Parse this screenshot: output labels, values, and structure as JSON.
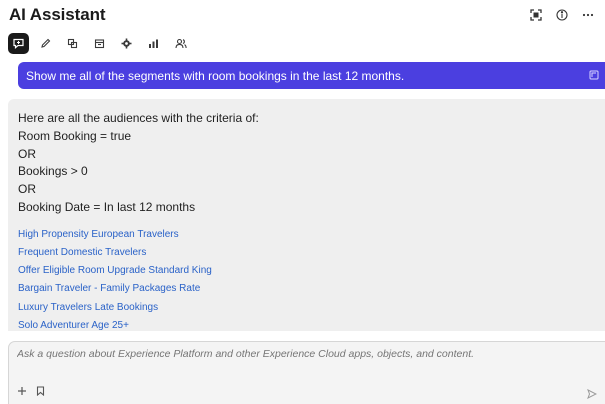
{
  "header": {
    "title": "AI Assistant",
    "icons": [
      "expand-icon",
      "info-icon",
      "more-icon"
    ]
  },
  "toolbar": {
    "tools": [
      {
        "name": "chat-tool",
        "icon": "chat-sparkle-icon",
        "active": true
      },
      {
        "name": "edit-tool",
        "icon": "pencil-icon",
        "active": false
      },
      {
        "name": "copy-tool",
        "icon": "duplicate-icon",
        "active": false
      },
      {
        "name": "calendar-tool",
        "icon": "calendar-icon",
        "active": false
      },
      {
        "name": "settings-tool",
        "icon": "gear-icon",
        "active": false
      },
      {
        "name": "chart-tool",
        "icon": "bar-chart-icon",
        "active": false
      },
      {
        "name": "audience-tool",
        "icon": "people-icon",
        "active": false
      }
    ]
  },
  "conversation": {
    "user_prompt": "Show me all of the segments with room bookings in the last 12 months.",
    "response_lines": [
      "Here are all the audiences with the criteria of:",
      "Room Booking = true",
      "OR",
      "Bookings > 0",
      "OR",
      "Booking Date = In last 12 months"
    ],
    "audience_links": [
      "High Propensity European Travelers",
      "Frequent Domestic Travelers",
      "Offer Eligible Room Upgrade Standard King",
      "Bargain Traveler - Family Packages Rate",
      "Luxury Travelers Late Bookings",
      "Solo Adventurer Age 25+"
    ]
  },
  "composer": {
    "placeholder": "Ask a question about Experience Platform and other Experience Cloud apps, objects, and content."
  },
  "colors": {
    "prompt_bubble": "#4b3fe0",
    "link": "#2a62c8",
    "response_bg": "#efefef"
  }
}
